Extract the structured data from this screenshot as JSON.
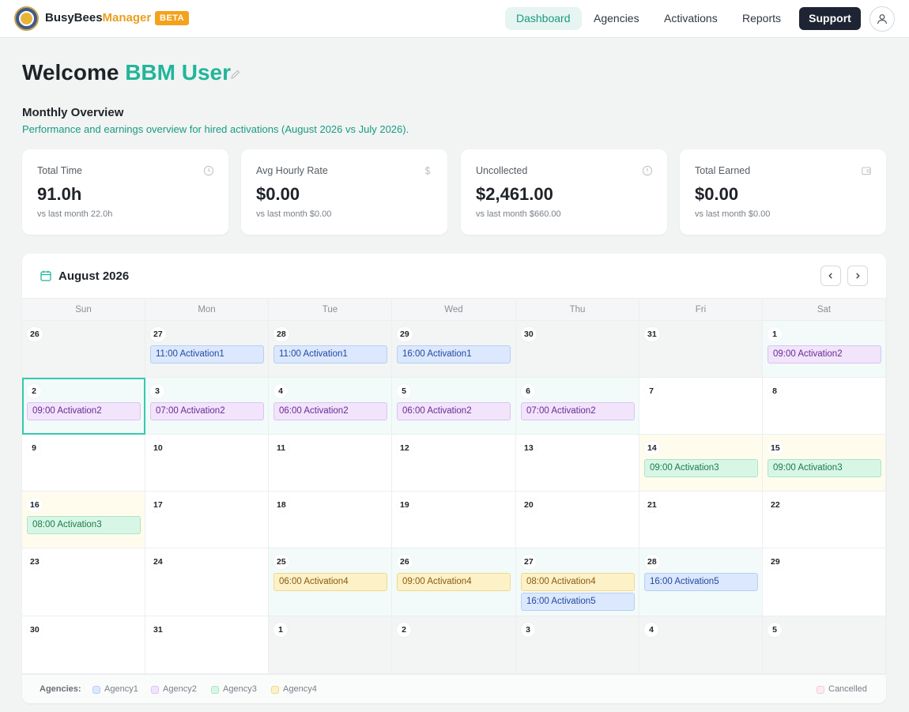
{
  "header": {
    "brand_part1": "BusyBees",
    "brand_part2": "Manager",
    "badge": "BETA",
    "nav": [
      {
        "label": "Dashboard",
        "active": true
      },
      {
        "label": "Agencies",
        "active": false
      },
      {
        "label": "Activations",
        "active": false
      },
      {
        "label": "Reports",
        "active": false
      }
    ],
    "support_label": "Support",
    "icons": {
      "logo": "bee-logo",
      "avatar": "user-icon"
    }
  },
  "welcome": {
    "prefix": "Welcome",
    "name": "BBM User",
    "edit_icon": "pencil-icon"
  },
  "overview": {
    "title": "Monthly Overview",
    "subtitle": "Performance and earnings overview for hired activations (August 2026 vs July 2026).",
    "cards": [
      {
        "label": "Total Time",
        "value": "91.0h",
        "compare": "vs last month 22.0h",
        "icon": "clock-icon"
      },
      {
        "label": "Avg Hourly Rate",
        "value": "$0.00",
        "compare": "vs last month $0.00",
        "icon": "dollar-icon"
      },
      {
        "label": "Uncollected",
        "value": "$2,461.00",
        "compare": "vs last month $660.00",
        "icon": "alert-circle-icon"
      },
      {
        "label": "Total Earned",
        "value": "$0.00",
        "compare": "vs last month $0.00",
        "icon": "wallet-icon"
      }
    ]
  },
  "calendar": {
    "title": "August 2026",
    "title_icon": "calendar-icon",
    "weekdays": [
      "Sun",
      "Mon",
      "Tue",
      "Wed",
      "Thu",
      "Fri",
      "Sat"
    ],
    "weeks": [
      [
        {
          "day": "26",
          "out": true,
          "events": []
        },
        {
          "day": "27",
          "out": true,
          "events": [
            {
              "time": "11:00",
              "name": "Activation1",
              "agency": "a1"
            }
          ]
        },
        {
          "day": "28",
          "out": true,
          "events": [
            {
              "time": "11:00",
              "name": "Activation1",
              "agency": "a1"
            }
          ]
        },
        {
          "day": "29",
          "out": true,
          "events": [
            {
              "time": "16:00",
              "name": "Activation1",
              "agency": "a1"
            }
          ]
        },
        {
          "day": "30",
          "out": true,
          "events": []
        },
        {
          "day": "31",
          "out": true,
          "events": []
        },
        {
          "day": "1",
          "tint": "teal",
          "events": [
            {
              "time": "09:00",
              "name": "Activation2",
              "agency": "a2"
            }
          ]
        }
      ],
      [
        {
          "day": "2",
          "tint": "teal",
          "today": true,
          "events": [
            {
              "time": "09:00",
              "name": "Activation2",
              "agency": "a2"
            }
          ]
        },
        {
          "day": "3",
          "tint": "teal",
          "events": [
            {
              "time": "07:00",
              "name": "Activation2",
              "agency": "a2"
            }
          ]
        },
        {
          "day": "4",
          "tint": "teal",
          "events": [
            {
              "time": "06:00",
              "name": "Activation2",
              "agency": "a2"
            }
          ]
        },
        {
          "day": "5",
          "tint": "teal",
          "events": [
            {
              "time": "06:00",
              "name": "Activation2",
              "agency": "a2"
            }
          ]
        },
        {
          "day": "6",
          "tint": "teal",
          "events": [
            {
              "time": "07:00",
              "name": "Activation2",
              "agency": "a2"
            }
          ]
        },
        {
          "day": "7",
          "events": []
        },
        {
          "day": "8",
          "events": []
        }
      ],
      [
        {
          "day": "9",
          "events": []
        },
        {
          "day": "10",
          "events": []
        },
        {
          "day": "11",
          "events": []
        },
        {
          "day": "12",
          "events": []
        },
        {
          "day": "13",
          "events": []
        },
        {
          "day": "14",
          "tint": "yellow",
          "events": [
            {
              "time": "09:00",
              "name": "Activation3",
              "agency": "a3"
            }
          ]
        },
        {
          "day": "15",
          "tint": "yellow",
          "events": [
            {
              "time": "09:00",
              "name": "Activation3",
              "agency": "a3"
            }
          ]
        }
      ],
      [
        {
          "day": "16",
          "tint": "yellow",
          "events": [
            {
              "time": "08:00",
              "name": "Activation3",
              "agency": "a3"
            }
          ]
        },
        {
          "day": "17",
          "events": []
        },
        {
          "day": "18",
          "events": []
        },
        {
          "day": "19",
          "events": []
        },
        {
          "day": "20",
          "events": []
        },
        {
          "day": "21",
          "events": []
        },
        {
          "day": "22",
          "events": []
        }
      ],
      [
        {
          "day": "23",
          "events": []
        },
        {
          "day": "24",
          "events": []
        },
        {
          "day": "25",
          "tint": "teal",
          "events": [
            {
              "time": "06:00",
              "name": "Activation4",
              "agency": "a4"
            }
          ]
        },
        {
          "day": "26",
          "tint": "teal",
          "events": [
            {
              "time": "09:00",
              "name": "Activation4",
              "agency": "a4"
            }
          ]
        },
        {
          "day": "27",
          "tint": "teal",
          "events": [
            {
              "time": "08:00",
              "name": "Activation4",
              "agency": "a4"
            },
            {
              "time": "16:00",
              "name": "Activation5",
              "agency": "a5"
            }
          ]
        },
        {
          "day": "28",
          "tint": "teal",
          "events": [
            {
              "time": "16:00",
              "name": "Activation5",
              "agency": "a5"
            }
          ]
        },
        {
          "day": "29",
          "events": []
        }
      ],
      [
        {
          "day": "30",
          "events": []
        },
        {
          "day": "31",
          "events": []
        },
        {
          "day": "1",
          "out": true,
          "events": []
        },
        {
          "day": "2",
          "out": true,
          "events": []
        },
        {
          "day": "3",
          "out": true,
          "events": []
        },
        {
          "day": "4",
          "out": true,
          "events": []
        },
        {
          "day": "5",
          "out": true,
          "events": []
        }
      ]
    ]
  },
  "legend": {
    "title": "Agencies:",
    "items": [
      {
        "label": "Agency1",
        "color": "#dbe8fd",
        "border": "#b8cff5"
      },
      {
        "label": "Agency2",
        "color": "#f1e4fb",
        "border": "#dcc3f2"
      },
      {
        "label": "Agency3",
        "color": "#d8f6e6",
        "border": "#a9e6c5"
      },
      {
        "label": "Agency4",
        "color": "#fdf1c8",
        "border": "#f1d98a"
      }
    ],
    "cancelled": {
      "label": "Cancelled",
      "color": "#fdecef",
      "border": "#f5c9d2"
    }
  },
  "colors": {
    "accent": "#22b59a",
    "brand_orange": "#f4a21c",
    "support_bg": "#1e2433"
  }
}
